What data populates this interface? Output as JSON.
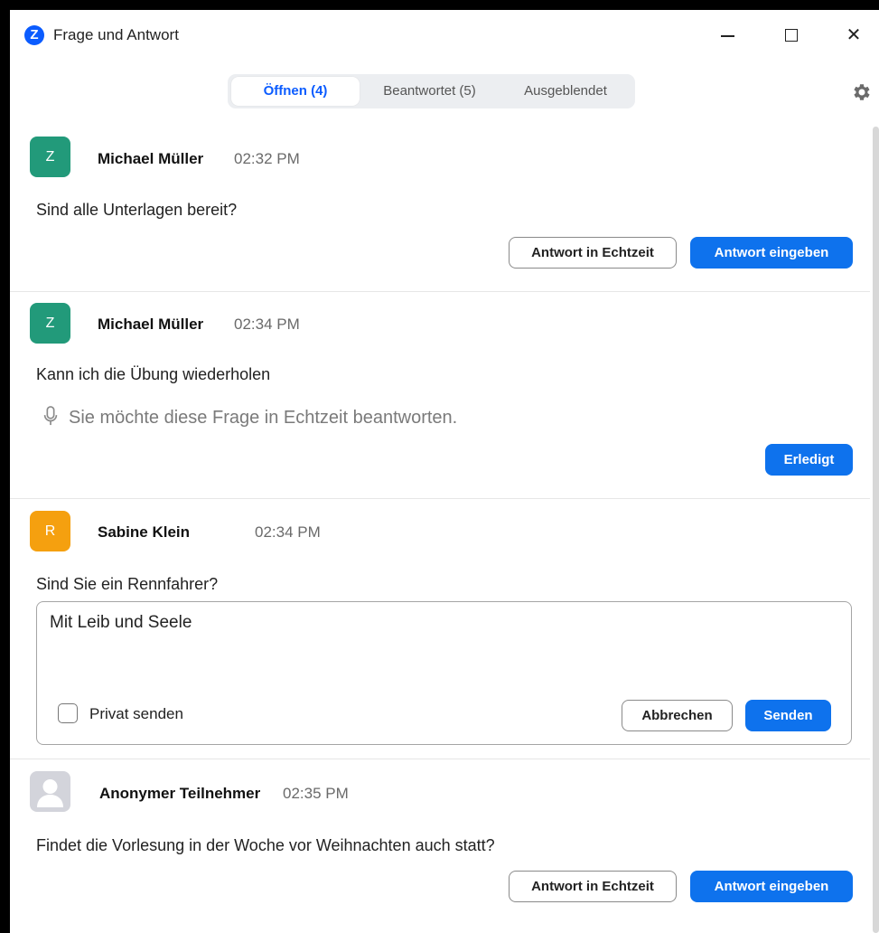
{
  "window": {
    "logo_letter": "Z",
    "title": "Frage und Antwort",
    "minimize": "",
    "maximize": "",
    "close": "✕"
  },
  "tabs": [
    {
      "label": "Öffnen (4)",
      "active": true
    },
    {
      "label": "Beantwortet (5)",
      "active": false
    },
    {
      "label": "Ausgeblendet",
      "active": false
    }
  ],
  "questions": [
    {
      "avatar_letter": "Z",
      "avatar_color": "#229a7a",
      "name": "Michael Müller",
      "time": "02:32 PM",
      "text": "Sind alle Unterlagen bereit?",
      "btn_live": "Antwort in Echtzeit",
      "btn_type": "Antwort eingeben"
    },
    {
      "avatar_letter": "Z",
      "avatar_color": "#229a7a",
      "name": "Michael Müller",
      "time": "02:34 PM",
      "text": "Kann ich die Übung wiederholen",
      "live_note": "Sie möchte diese Frage in Echtzeit beantworten.",
      "btn_done": "Erledigt"
    },
    {
      "avatar_letter": "R",
      "avatar_color": "#f5a00f",
      "name": "Sabine Klein",
      "time": "02:34 PM",
      "text": "Sind Sie ein Rennfahrer?",
      "reply_text": "Mit Leib und Seele",
      "private_label": "Privat senden",
      "btn_cancel": "Abbrechen",
      "btn_send": "Senden"
    },
    {
      "avatar_color": "#d3d4db",
      "name": "Anonymer Teilnehmer",
      "time": "02:35 PM",
      "text": "Findet die Vorlesung in der Woche vor Weihnachten auch statt?",
      "btn_live": "Antwort in Echtzeit",
      "btn_type": "Antwort eingeben"
    }
  ],
  "colors": {
    "accent": "#0e72ed",
    "tab_active_text": "#0b5cff"
  }
}
